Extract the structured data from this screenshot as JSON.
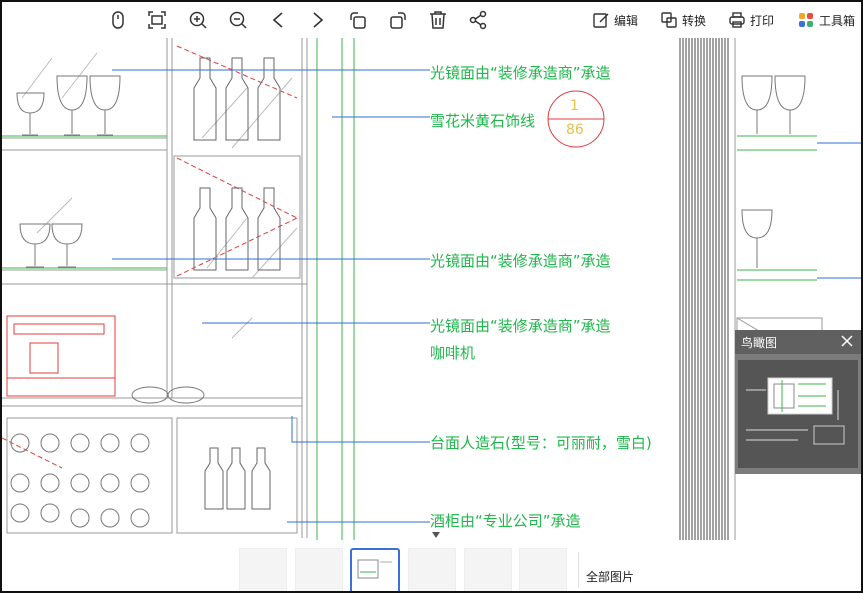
{
  "toolbar": {
    "icons": [
      "mouse-icon",
      "fit-screen-icon",
      "zoom-in-icon",
      "zoom-out-icon",
      "previous-icon",
      "next-icon",
      "rotate-left-icon",
      "rotate-right-icon",
      "delete-icon",
      "share-icon"
    ],
    "edit_label": "编辑",
    "convert_label": "转换",
    "print_label": "打印",
    "tools_label": "工具箱"
  },
  "drawing": {
    "annotations": [
      "光镜面由“装修承造商”承造",
      "雪花米黄石饰线",
      "光镜面由“装修承造商”承造",
      "光镜面由“装修承造商”承造",
      "咖啡机",
      "台面人造石(型号：可丽耐，雪白)",
      "酒柜由“专业公司”承造"
    ],
    "section_mark_top": "1",
    "section_mark_bottom": "86"
  },
  "birdseye": {
    "title": "鸟瞰图"
  },
  "thumbnails": {
    "count": 6,
    "active_index": 2,
    "all_label": "全部图片"
  },
  "colors": {
    "annotation_green": "#1fb84b",
    "leader_blue": "#2f6fd6",
    "cad_red": "#e03c3c",
    "accent": "#3d6fd8"
  }
}
